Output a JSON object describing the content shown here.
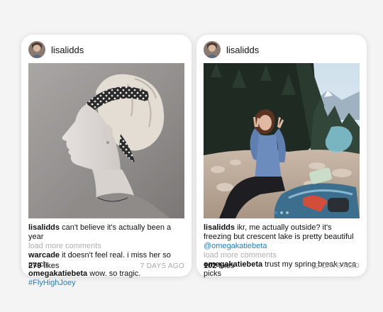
{
  "posts": [
    {
      "username": "lisalidds",
      "caption": {
        "author": "lisalidds",
        "text": "can't believe it's actually been a year"
      },
      "load_more": "load more comments",
      "comments": [
        {
          "author": "warcade",
          "text": "it doesn't feel real. i miss her so much",
          "tag": ""
        },
        {
          "author": "omegakatiebeta",
          "text": "wow. so tragic.",
          "tag": "#FlyHighJoey"
        }
      ],
      "likes_count": "279",
      "likes_label": "likes",
      "timestamp": "7 DAYS AGO"
    },
    {
      "username": "lisalidds",
      "caption": {
        "author": "lisalidds",
        "text": "ikr, me actually outside? it's freezing but crescent lake is pretty beautiful",
        "tag": "@omegakatiebeta"
      },
      "load_more": "load more comments",
      "comments": [
        {
          "author": "omegakatiebeta",
          "text": "trust my spring break vaca picks",
          "tag": ""
        }
      ],
      "likes_count": "102",
      "likes_label": "likes",
      "timestamp": "12 DAYS AGO",
      "carousel": {
        "dots": 3,
        "active_index": 0
      }
    }
  ],
  "colors": {
    "background": "#f4f4f4",
    "card": "#ffffff",
    "hashtag": "#2a7bc0",
    "muted": "#b0b0b0",
    "carousel_active": "#3b86d6"
  }
}
